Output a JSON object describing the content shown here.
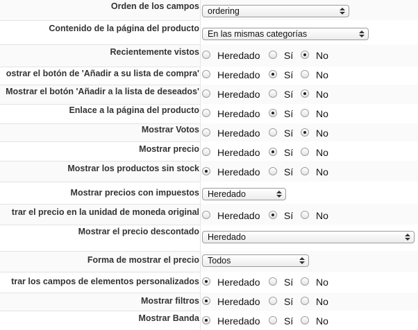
{
  "radio_options": {
    "inherited": "Heredado",
    "yes": "Sí",
    "no": "No"
  },
  "fields": {
    "field_order": {
      "label": "Orden de los campos",
      "value": "ordering"
    },
    "product_page_content": {
      "label": "Contenido de la página del producto",
      "value": "En las mismas categorías"
    },
    "recently_viewed": {
      "label": "Recientemente vistos",
      "selected": "no"
    },
    "show_add_to_shopping_list": {
      "label": "ostrar el botón de 'Añadir a su lista de compra'",
      "selected": "yes"
    },
    "show_add_to_wishlist": {
      "label": "Mostrar el botón 'Añadir a la lista de deseados'",
      "selected": "no"
    },
    "product_page_link": {
      "label": "Enlace a la página del producto",
      "selected": "yes"
    },
    "show_votes": {
      "label": "Mostrar Votos",
      "selected": "no"
    },
    "show_price": {
      "label": "Mostrar precio",
      "selected": "yes"
    },
    "show_out_of_stock": {
      "label": "Mostrar los productos sin stock",
      "selected": "inherited"
    },
    "show_prices_with_tax": {
      "label": "Mostrar precios con impuestos",
      "value": "Heredado"
    },
    "show_price_original_currency": {
      "label": "trar el precio en la unidad de moneda original",
      "selected": "yes"
    },
    "show_discounted_price": {
      "label": "Mostrar el precio descontado",
      "value": "Heredado"
    },
    "price_display_mode": {
      "label": "Forma de mostrar el precio",
      "value": "Todos"
    },
    "show_custom_item_fields": {
      "label": "trar los campos de elementos personalizados",
      "selected": "inherited"
    },
    "show_filters": {
      "label": "Mostrar filtros",
      "selected": "inherited"
    },
    "show_band": {
      "label": "Mostrar Banda",
      "selected": "inherited"
    }
  }
}
